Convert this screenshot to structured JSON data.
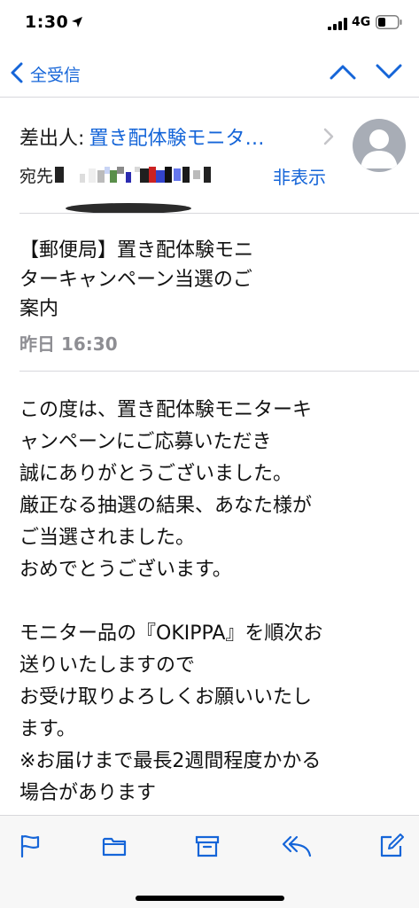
{
  "status_bar": {
    "time": "1:30",
    "network": "4G"
  },
  "nav": {
    "back_label": "全受信"
  },
  "header": {
    "sender_label": "差出人:",
    "sender_name": "置き配体験モニタ…",
    "to_label": "宛先",
    "hide_label": "非表示"
  },
  "subject": {
    "lines": [
      "【郵便局】置き配体験モニ",
      "ターキャンペーン当選のご",
      "案内"
    ],
    "date": "昨日 16:30"
  },
  "body": {
    "lines": [
      "この度は、置き配体験モニターキ",
      "ャンペーンにご応募いただき",
      "誠にありがとうございました。",
      "厳正なる抽選の結果、あなた様が",
      "ご当選されました。",
      "おめでとうございます。",
      "",
      "モニター品の『OKIPPA』を順次お",
      "送りいたしますので",
      "お受け取りよろしくお願いいたし",
      "ます。",
      "※お届けまで最長2週間程度かかる",
      "場合があります"
    ]
  },
  "colors": {
    "accent": "#1565d8",
    "gray": "#8e8e93",
    "separator": "#d8d8dc"
  },
  "toolbar": {
    "icons": [
      "flag-icon",
      "folder-icon",
      "archive-icon",
      "reply-icon",
      "compose-icon"
    ]
  }
}
